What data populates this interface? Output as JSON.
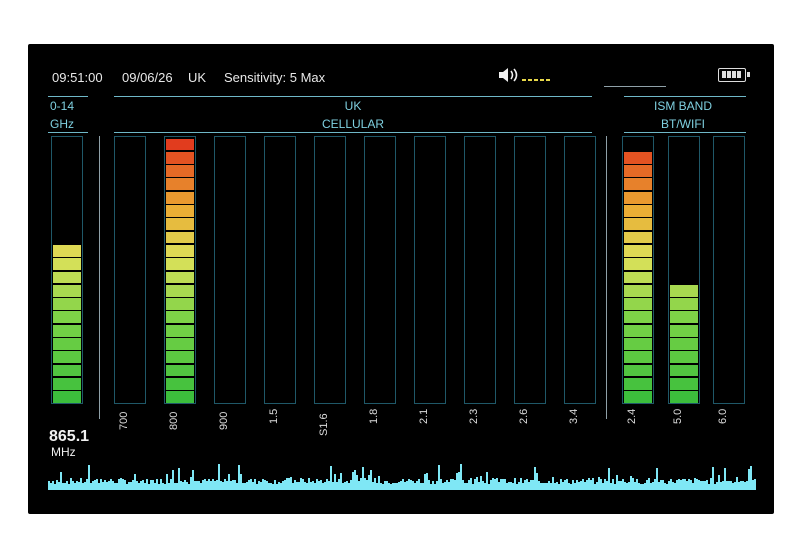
{
  "status": {
    "time": "09:51:00",
    "date": "09/06/26",
    "region": "UK",
    "sensitivity": "Sensitivity: 5 Max",
    "volume_icon": "speaker-icon",
    "battery_icon": "battery-icon"
  },
  "wideband": {
    "title_line1": "0-14",
    "title_line2": "GHz",
    "level": 0.62
  },
  "cellular": {
    "title_line1": "UK",
    "title_line2": "CELLULAR",
    "bands": [
      {
        "label": "700",
        "level": 0.0
      },
      {
        "label": "800",
        "level": 1.0
      },
      {
        "label": "900",
        "level": 0.0
      },
      {
        "label": "1.5",
        "level": 0.0
      },
      {
        "label": "S1.6",
        "level": 0.0
      },
      {
        "label": "1.8",
        "level": 0.0
      },
      {
        "label": "2.1",
        "level": 0.0
      },
      {
        "label": "2.3",
        "level": 0.0
      },
      {
        "label": "2.6",
        "level": 0.0
      },
      {
        "label": "3.4",
        "level": 0.0
      }
    ]
  },
  "ism": {
    "title_line1": "ISM BAND",
    "title_line2": "BT/WIFI",
    "bands": [
      {
        "label": "2.4",
        "level": 0.95
      },
      {
        "label": "5.0",
        "level": 0.44
      },
      {
        "label": "6.0",
        "level": 0.0
      }
    ]
  },
  "frequency": {
    "value": "865.1",
    "unit": "MHz"
  },
  "colors": {
    "bar_border": "#1f5868",
    "header_text": "#7fd0e0",
    "spectrum": "#7fe7f5"
  }
}
